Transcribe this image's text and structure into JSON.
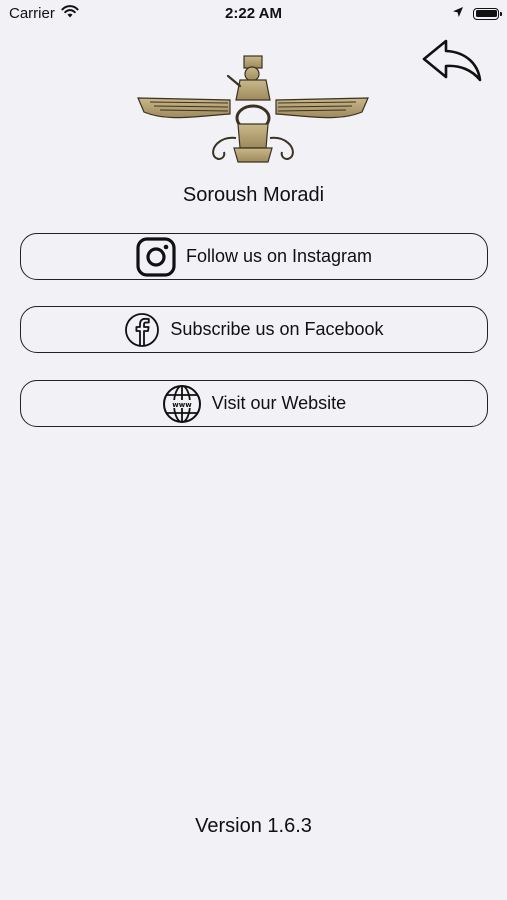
{
  "status_bar": {
    "carrier": "Carrier",
    "time": "2:22 AM"
  },
  "header": {
    "back_icon": "back-arrow-icon"
  },
  "profile": {
    "logo_icon": "faravahar-logo",
    "name": "Soroush Moradi"
  },
  "links": [
    {
      "label": "Follow us on Instagram",
      "icon": "instagram-icon"
    },
    {
      "label": "Subscribe us on Facebook",
      "icon": "facebook-icon"
    },
    {
      "label": "Visit our Website",
      "icon": "globe-icon"
    }
  ],
  "footer": {
    "version": "Version 1.6.3"
  },
  "colors": {
    "background": "#f1f1f6",
    "logo_gold": "#b7a271",
    "text": "#111111"
  }
}
